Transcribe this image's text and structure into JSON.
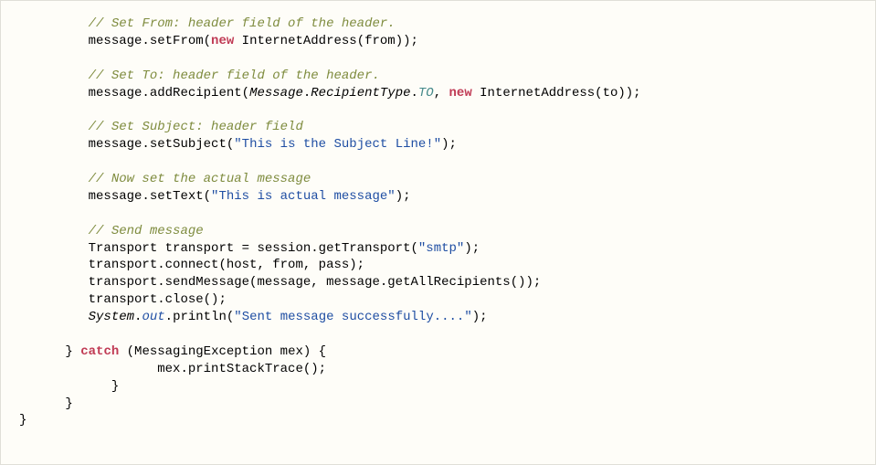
{
  "code": {
    "lines": [
      {
        "indent": "         ",
        "segs": [
          {
            "cls": "c-comment",
            "t": "// Set From: header field of the header."
          }
        ]
      },
      {
        "indent": "         ",
        "segs": [
          {
            "cls": "",
            "t": "message.setFrom("
          },
          {
            "cls": "c-keyword",
            "t": "new"
          },
          {
            "cls": "",
            "t": " InternetAddress(from));"
          }
        ]
      },
      {
        "indent": "",
        "segs": [
          {
            "cls": "",
            "t": ""
          }
        ]
      },
      {
        "indent": "         ",
        "segs": [
          {
            "cls": "c-comment",
            "t": "// Set To: header field of the header."
          }
        ]
      },
      {
        "indent": "         ",
        "segs": [
          {
            "cls": "",
            "t": "message.addRecipient("
          },
          {
            "cls": "c-class",
            "t": "Message"
          },
          {
            "cls": "",
            "t": "."
          },
          {
            "cls": "c-class",
            "t": "RecipientType"
          },
          {
            "cls": "",
            "t": "."
          },
          {
            "cls": "c-static",
            "t": "TO"
          },
          {
            "cls": "",
            "t": ", "
          },
          {
            "cls": "c-keyword",
            "t": "new"
          },
          {
            "cls": "",
            "t": " InternetAddress(to));"
          }
        ]
      },
      {
        "indent": "",
        "segs": [
          {
            "cls": "",
            "t": ""
          }
        ]
      },
      {
        "indent": "         ",
        "segs": [
          {
            "cls": "c-comment",
            "t": "// Set Subject: header field"
          }
        ]
      },
      {
        "indent": "         ",
        "segs": [
          {
            "cls": "",
            "t": "message.setSubject("
          },
          {
            "cls": "c-string",
            "t": "\"This is the Subject Line!\""
          },
          {
            "cls": "",
            "t": ");"
          }
        ]
      },
      {
        "indent": "",
        "segs": [
          {
            "cls": "",
            "t": ""
          }
        ]
      },
      {
        "indent": "         ",
        "segs": [
          {
            "cls": "c-comment",
            "t": "// Now set the actual message"
          }
        ]
      },
      {
        "indent": "         ",
        "segs": [
          {
            "cls": "",
            "t": "message.setText("
          },
          {
            "cls": "c-string",
            "t": "\"This is actual message\""
          },
          {
            "cls": "",
            "t": ");"
          }
        ]
      },
      {
        "indent": "",
        "segs": [
          {
            "cls": "",
            "t": ""
          }
        ]
      },
      {
        "indent": "         ",
        "segs": [
          {
            "cls": "c-comment",
            "t": "// Send message"
          }
        ]
      },
      {
        "indent": "         ",
        "segs": [
          {
            "cls": "",
            "t": "Transport transport = session.getTransport("
          },
          {
            "cls": "c-string",
            "t": "\"smtp\""
          },
          {
            "cls": "",
            "t": ");"
          }
        ]
      },
      {
        "indent": "         ",
        "segs": [
          {
            "cls": "",
            "t": "transport.connect(host, from, pass);"
          }
        ]
      },
      {
        "indent": "         ",
        "segs": [
          {
            "cls": "",
            "t": "transport.sendMessage(message, message.getAllRecipients());"
          }
        ]
      },
      {
        "indent": "         ",
        "segs": [
          {
            "cls": "",
            "t": "transport.close();"
          }
        ]
      },
      {
        "indent": "         ",
        "segs": [
          {
            "cls": "c-class",
            "t": "System"
          },
          {
            "cls": "",
            "t": "."
          },
          {
            "cls": "c-field",
            "t": "out"
          },
          {
            "cls": "",
            "t": ".println("
          },
          {
            "cls": "c-string",
            "t": "\"Sent message successfully....\""
          },
          {
            "cls": "",
            "t": ");"
          }
        ]
      },
      {
        "indent": "",
        "segs": [
          {
            "cls": "",
            "t": ""
          }
        ]
      },
      {
        "indent": "      ",
        "segs": [
          {
            "cls": "",
            "t": "} "
          },
          {
            "cls": "c-keyword",
            "t": "catch"
          },
          {
            "cls": "",
            "t": " (MessagingException mex) {"
          }
        ]
      },
      {
        "indent": "                  ",
        "segs": [
          {
            "cls": "",
            "t": "mex.printStackTrace();"
          }
        ]
      },
      {
        "indent": "            ",
        "segs": [
          {
            "cls": "",
            "t": "}"
          }
        ]
      },
      {
        "indent": "      ",
        "segs": [
          {
            "cls": "",
            "t": "}"
          }
        ]
      },
      {
        "indent": "",
        "segs": [
          {
            "cls": "",
            "t": "}"
          }
        ]
      }
    ]
  }
}
